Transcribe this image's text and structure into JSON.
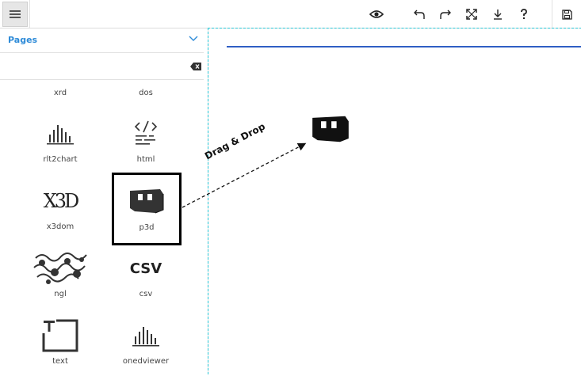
{
  "toolbar": {
    "icons": [
      "menu-icon",
      "eye-icon",
      "undo-icon",
      "redo-icon",
      "expand-icon",
      "download-icon",
      "help-icon",
      "save-icon"
    ]
  },
  "sidebar": {
    "title": "Pages",
    "search": {
      "value": "",
      "placeholder": ""
    },
    "items": [
      {
        "label": "xrd",
        "icon": "xrd-icon"
      },
      {
        "label": "dos",
        "icon": "dos-icon"
      },
      {
        "label": "rlt2chart",
        "icon": "bar-chart-icon"
      },
      {
        "label": "html",
        "icon": "code-icon"
      },
      {
        "label": "x3dom",
        "icon": "x3d-icon"
      },
      {
        "label": "p3d",
        "icon": "3d-structure-icon"
      },
      {
        "label": "ngl",
        "icon": "molecule-icon"
      },
      {
        "label": "csv",
        "icon": "csv-icon"
      },
      {
        "label": "text",
        "icon": "text-icon"
      },
      {
        "label": "onedviewer",
        "icon": "bar-chart-icon"
      }
    ],
    "csv_glyph": "CSV",
    "x3d_glyph": "X3D"
  },
  "canvas": {
    "annotation": "Drag & Drop"
  }
}
